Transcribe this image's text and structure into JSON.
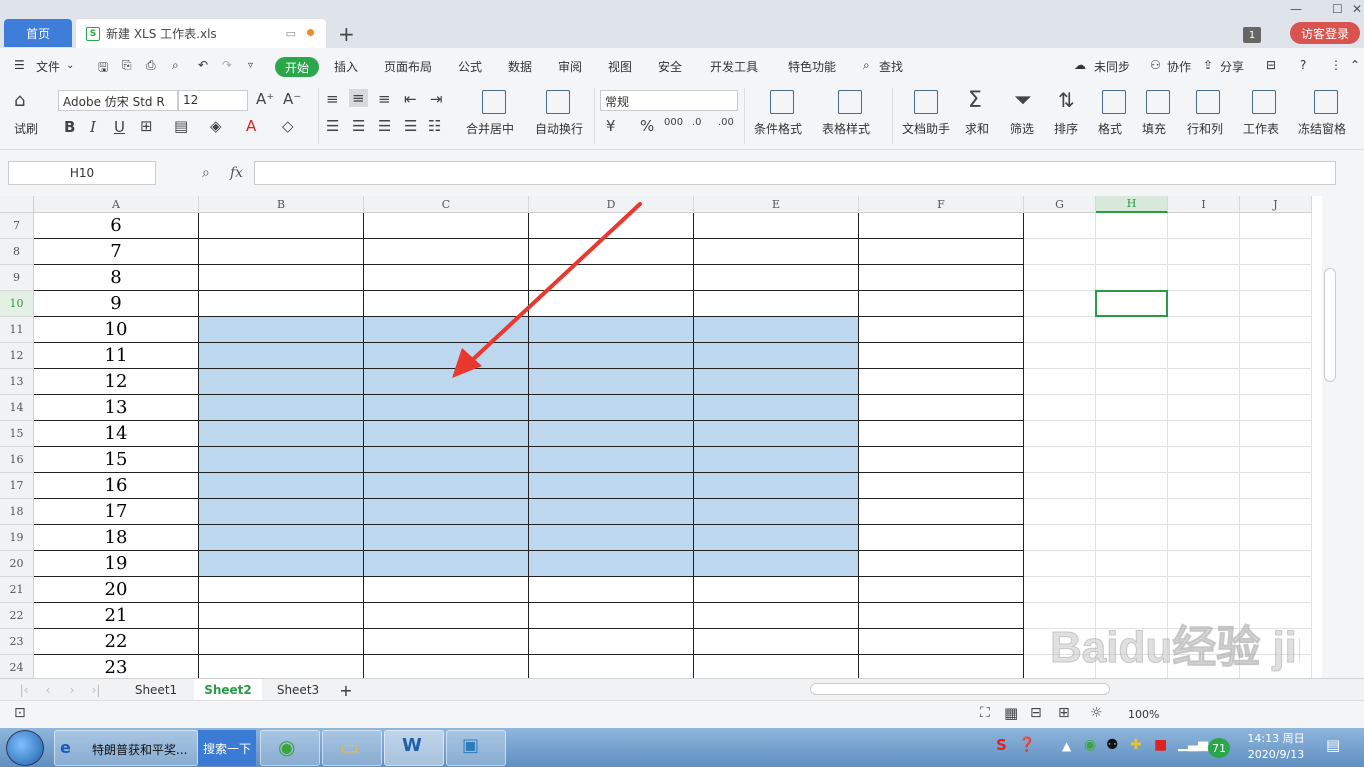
{
  "tabs": {
    "home": "首页",
    "doc": "新建 XLS 工作表.xls",
    "count": "1",
    "login": "访客登录"
  },
  "menu": {
    "file": "文件",
    "items": [
      "开始",
      "插入",
      "页面布局",
      "公式",
      "数据",
      "审阅",
      "视图",
      "安全",
      "开发工具",
      "特色功能"
    ],
    "search": "查找",
    "right": [
      "未同步",
      "协作",
      "分享"
    ]
  },
  "ribbon": {
    "format_painter": "试刷",
    "font_name": "Adobe 仿宋 Std R",
    "font_size": "12",
    "merge": "合并居中",
    "wrap": "自动换行",
    "number_format": "常规",
    "cond_format": "条件格式",
    "table_style": "表格样式",
    "doc_helper": "文档助手",
    "sum": "求和",
    "filter": "筛选",
    "sort": "排序",
    "format": "格式",
    "fill": "填充",
    "rowcol": "行和列",
    "worksheet": "工作表",
    "freeze": "冻结窗格"
  },
  "formula": {
    "namebox": "H10",
    "fx": "fx"
  },
  "grid": {
    "columns": [
      "A",
      "B",
      "C",
      "D",
      "E",
      "F",
      "G",
      "H",
      "I",
      "J"
    ],
    "rows": [
      "7",
      "8",
      "9",
      "10",
      "11",
      "12",
      "13",
      "14",
      "15",
      "16",
      "17",
      "18",
      "19",
      "20",
      "21",
      "22",
      "23",
      "24"
    ],
    "values": [
      "6",
      "7",
      "8",
      "9",
      "10",
      "11",
      "12",
      "13",
      "14",
      "15",
      "16",
      "17",
      "18",
      "19",
      "20",
      "21",
      "22",
      "23"
    ],
    "active_col": "H",
    "active_row": "10",
    "selection_color": "#bdd7ee",
    "arrow_color": "#e8382f"
  },
  "sheets": [
    "Sheet1",
    "Sheet2",
    "Sheet3"
  ],
  "active_sheet": "Sheet2",
  "status": {
    "zoom": "100%"
  },
  "taskbar": {
    "ie_text": "特朗普获和平奖...",
    "search": "搜索一下",
    "badge": "71",
    "time": "14:13 周日",
    "date": "2020/9/13"
  },
  "watermark": "Baidu经验 jingyan.baidu.com"
}
